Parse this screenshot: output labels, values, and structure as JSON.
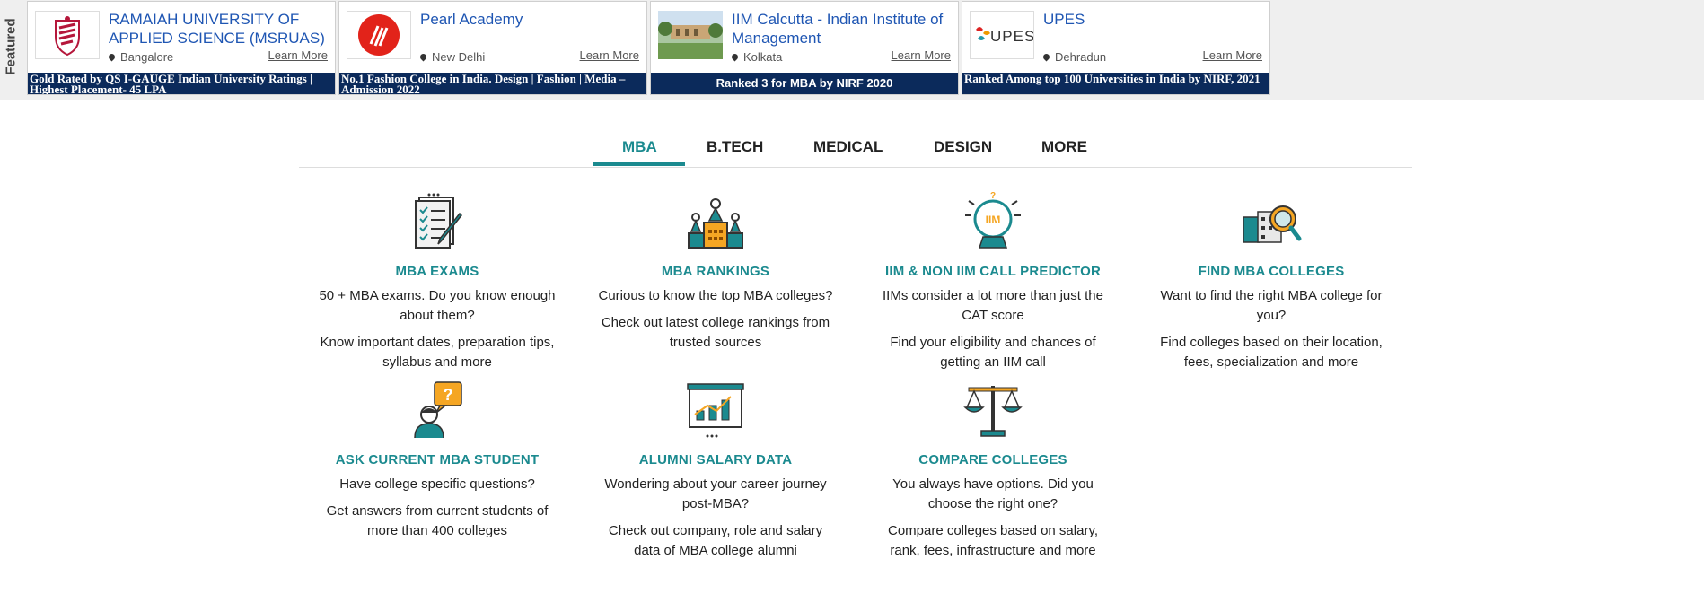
{
  "featured": {
    "label": "Featured",
    "cards": [
      {
        "name": "RAMAIAH UNIVERSITY OF APPLIED SCIENCE (MSRUAS)",
        "location": "Bangalore",
        "learn_more": "Learn More",
        "banner": "Gold Rated by QS I-GAUGE Indian University Ratings | Highest Placement- 45 LPA"
      },
      {
        "name": "Pearl Academy",
        "location": "New Delhi",
        "learn_more": "Learn More",
        "banner": "No.1 Fashion College in India. Design | Fashion | Media – Admission 2022"
      },
      {
        "name": "IIM Calcutta - Indian Institute of Management",
        "location": "Kolkata",
        "learn_more": "Learn More",
        "banner": "Ranked 3 for MBA by NIRF 2020"
      },
      {
        "name": "UPES",
        "location": "Dehradun",
        "learn_more": "Learn More",
        "banner": "Ranked Among top 100 Universities in India by NIRF, 2021",
        "logo_text": "UPES"
      }
    ]
  },
  "tabs": [
    "MBA",
    "B.TECH",
    "MEDICAL",
    "DESIGN",
    "MORE"
  ],
  "active_tab": "MBA",
  "accent_color": "#1b8a8f",
  "items": [
    {
      "icon": "exam-checklist-icon",
      "title": "MBA EXAMS",
      "p1": "50 + MBA exams. Do you know enough about them?",
      "p2": "Know important dates, preparation tips, syllabus and more"
    },
    {
      "icon": "rankings-podium-icon",
      "title": "MBA RANKINGS",
      "p1": "Curious to know the top MBA colleges?",
      "p2": "Check out latest college rankings from trusted sources"
    },
    {
      "icon": "crystal-ball-icon",
      "icon_text": "IIM",
      "title": "IIM & NON IIM CALL PREDICTOR",
      "p1": "IIMs consider a lot more than just the CAT score",
      "p2": "Find your eligibility and chances of getting an IIM call"
    },
    {
      "icon": "find-colleges-icon",
      "title": "FIND MBA COLLEGES",
      "p1": "Want to find the right MBA college for you?",
      "p2": "Find colleges based on their location, fees, specialization and more"
    },
    {
      "icon": "ask-student-icon",
      "title": "ASK CURRENT MBA STUDENT",
      "p1": "Have college specific questions?",
      "p2": "Get answers from current students of more than 400 colleges"
    },
    {
      "icon": "salary-chart-icon",
      "title": "ALUMNI SALARY DATA",
      "p1": "Wondering about your career journey post-MBA?",
      "p2": "Check out company, role and salary data of MBA college alumni"
    },
    {
      "icon": "scales-icon",
      "title": "COMPARE COLLEGES",
      "p1": "You always have options. Did you choose the right one?",
      "p2": "Compare colleges based on salary, rank, fees, infrastructure and more"
    }
  ]
}
